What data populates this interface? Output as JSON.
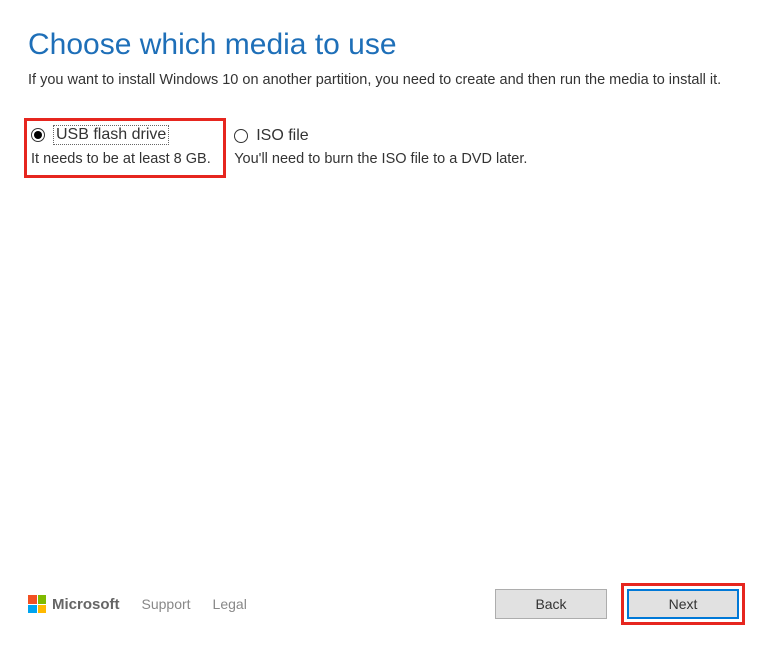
{
  "title": "Choose which media to use",
  "subtitle": "If you want to install Windows 10 on another partition, you need to create and then run the media to install it.",
  "options": [
    {
      "label": "USB flash drive",
      "description": "It needs to be at least 8 GB.",
      "selected": true,
      "highlighted": true,
      "focused": true
    },
    {
      "label": "ISO file",
      "description": "You'll need to burn the ISO file to a DVD later.",
      "selected": false,
      "highlighted": false,
      "focused": false
    }
  ],
  "footer": {
    "brand": "Microsoft",
    "support_label": "Support",
    "legal_label": "Legal",
    "back_label": "Back",
    "next_label": "Next"
  }
}
